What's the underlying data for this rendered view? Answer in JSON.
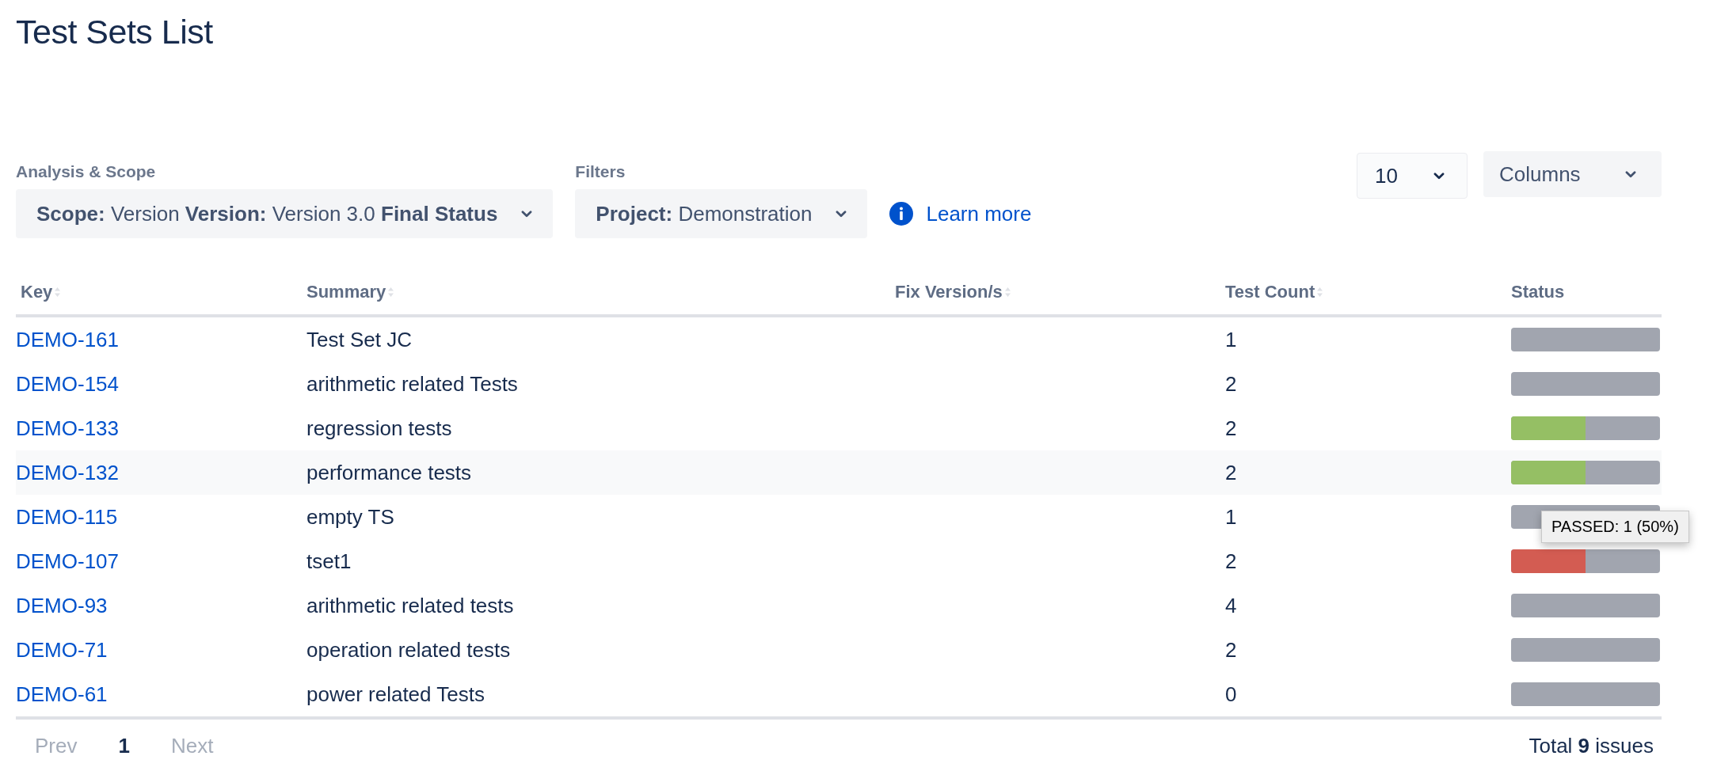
{
  "title": "Test Sets List",
  "analysis_scope": {
    "label": "Analysis & Scope",
    "value": "**Scope:** Version **Version:** Version 3.0 **Final Status**"
  },
  "filters": {
    "label": "Filters",
    "value": "**Project:** Demonstration",
    "link": "Learn more"
  },
  "page_size": {
    "value": "10"
  },
  "columns_button": {
    "label": "Columns"
  },
  "table": {
    "columns": [
      {
        "label": "Key",
        "sortable": true
      },
      {
        "label": "Summary",
        "sortable": true
      },
      {
        "label": "Fix Version/s",
        "sortable": true
      },
      {
        "label": "Test Count",
        "sortable": true
      },
      {
        "label": "Status",
        "sortable": false
      }
    ],
    "rows": [
      {
        "key": "DEMO-161",
        "summary": "Test Set JC",
        "test_count": "1",
        "hovered": false,
        "status": []
      },
      {
        "key": "DEMO-154",
        "summary": "arithmetic related Tests",
        "test_count": "2",
        "hovered": false,
        "status": []
      },
      {
        "key": "DEMO-133",
        "summary": "regression tests",
        "test_count": "2",
        "hovered": false,
        "status": [
          {
            "color": "#95bf64",
            "level": 0.5
          }
        ]
      },
      {
        "key": "DEMO-132",
        "summary": "performance tests",
        "test_count": "2",
        "hovered": true,
        "status": [
          {
            "color": "#95bf64",
            "level": 0.5
          }
        ]
      },
      {
        "key": "DEMO-115",
        "summary": "empty TS",
        "test_count": "1",
        "hovered": false,
        "status": [],
        "tooltip": "PASSED: 1 (50%)"
      },
      {
        "key": "DEMO-107",
        "summary": "tset1",
        "test_count": "2",
        "hovered": false,
        "status": [
          {
            "color": "#d35c52",
            "level": 0.5
          }
        ]
      },
      {
        "key": "DEMO-93",
        "summary": "arithmetic related tests",
        "test_count": "4",
        "hovered": false,
        "status": []
      },
      {
        "key": "DEMO-71",
        "summary": "operation related tests",
        "test_count": "2",
        "hovered": false,
        "status": []
      },
      {
        "key": "DEMO-61",
        "summary": "power related Tests",
        "test_count": "0",
        "hovered": false,
        "status": []
      }
    ]
  },
  "pagination": {
    "prev": {
      "label": "Prev",
      "disabled": true
    },
    "pages": [
      {
        "label": "1",
        "selected": true
      }
    ],
    "next": {
      "label": "Next",
      "disabled": true
    }
  },
  "total": "Total **9** issues"
}
